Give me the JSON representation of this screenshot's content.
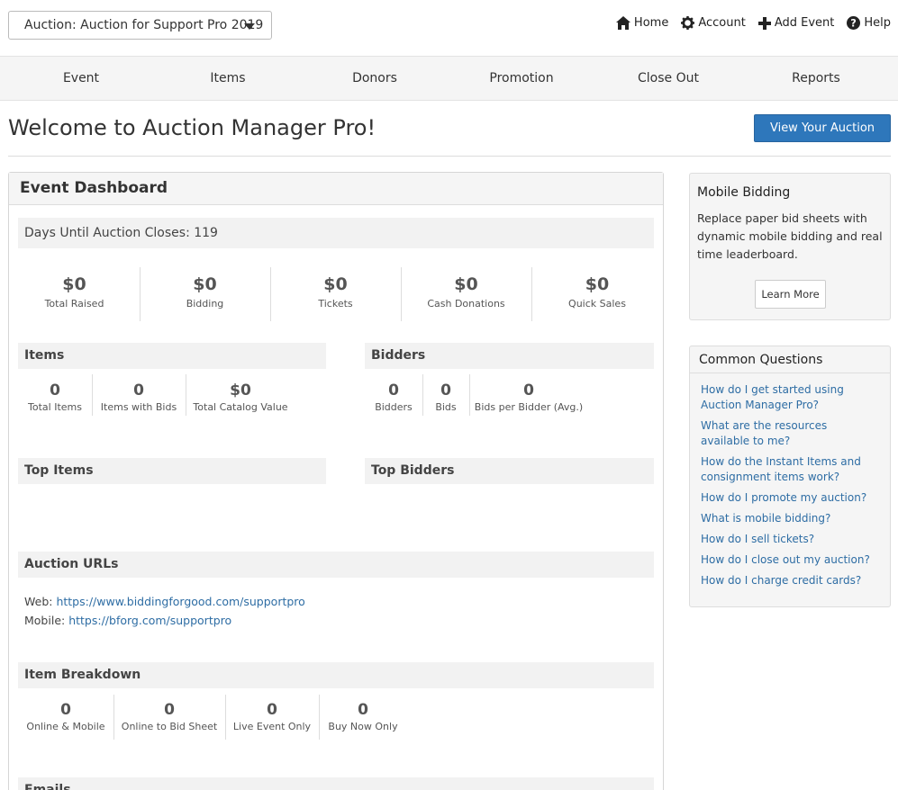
{
  "header": {
    "auction_select": "Auction: Auction for Support Pro 2019",
    "links": [
      {
        "label": "Home",
        "icon": "home-icon"
      },
      {
        "label": "Account",
        "icon": "gear-icon"
      },
      {
        "label": "Add Event",
        "icon": "plus-icon"
      },
      {
        "label": "Help",
        "icon": "question-icon"
      }
    ]
  },
  "nav": [
    "Event",
    "Items",
    "Donors",
    "Promotion",
    "Close Out",
    "Reports"
  ],
  "page": {
    "title": "Welcome to Auction Manager Pro!",
    "view_button": "View Your Auction"
  },
  "dashboard": {
    "title": "Event Dashboard",
    "days_label": "Days Until Auction Closes: 119",
    "totals": [
      {
        "value": "$0",
        "label": "Total Raised"
      },
      {
        "value": "$0",
        "label": "Bidding"
      },
      {
        "value": "$0",
        "label": "Tickets"
      },
      {
        "value": "$0",
        "label": "Cash Donations"
      },
      {
        "value": "$0",
        "label": "Quick Sales"
      }
    ],
    "items": {
      "title": "Items",
      "stats": [
        {
          "value": "0",
          "label": "Total Items"
        },
        {
          "value": "0",
          "label": "Items with Bids"
        },
        {
          "value": "$0",
          "label": "Total Catalog Value"
        }
      ]
    },
    "bidders": {
      "title": "Bidders",
      "stats": [
        {
          "value": "0",
          "label": "Bidders"
        },
        {
          "value": "0",
          "label": "Bids"
        },
        {
          "value": "0",
          "label": "Bids per Bidder (Avg.)"
        }
      ]
    },
    "top_items": "Top Items",
    "top_bidders": "Top Bidders",
    "urls": {
      "title": "Auction URLs",
      "web_label": "Web:",
      "web_url": "https://www.biddingforgood.com/supportpro",
      "mobile_label": "Mobile:",
      "mobile_url": "https://bforg.com/supportpro"
    },
    "breakdown": {
      "title": "Item Breakdown",
      "stats": [
        {
          "value": "0",
          "label": "Online & Mobile"
        },
        {
          "value": "0",
          "label": "Online to Bid Sheet"
        },
        {
          "value": "0",
          "label": "Live Event Only"
        },
        {
          "value": "0",
          "label": "Buy Now Only"
        }
      ]
    },
    "emails_title": "Emails"
  },
  "mobile_bidding": {
    "title": "Mobile Bidding",
    "text": "Replace paper bid sheets with dynamic mobile bidding and real time leaderboard.",
    "button": "Learn More"
  },
  "common_questions": {
    "title": "Common Questions",
    "items": [
      "How do I get started using Auction Manager Pro?",
      "What are the resources available to me?",
      "How do the Instant Items and consignment items work?",
      "How do I promote my auction?",
      "What is mobile bidding?",
      "How do I sell tickets?",
      "How do I close out my auction?",
      "How do I charge credit cards?"
    ]
  },
  "colors": {
    "primary": "#2e77bb",
    "link": "#2e6da4"
  }
}
